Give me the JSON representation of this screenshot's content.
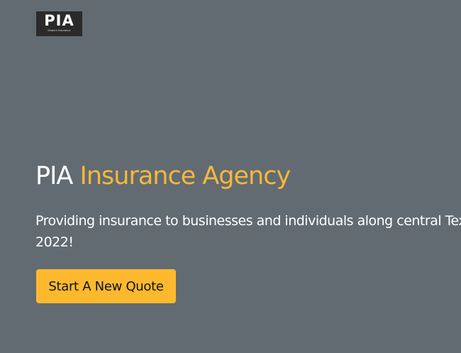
{
  "header": {
    "logo_text": "PIA",
    "logo_tagline": "Modern Insurance"
  },
  "hero": {
    "title_plain": "PIA",
    "title_accent": "Insurance Agency",
    "subtitle_line1": "Providing insurance to businesses and individuals along central Texas",
    "subtitle_line2": "2022!",
    "cta_label": "Start A New Quote"
  },
  "colors": {
    "background": "#636b72",
    "accent": "#f5b83a",
    "button": "#fdb92e",
    "logo_background": "#2a2a2a"
  }
}
